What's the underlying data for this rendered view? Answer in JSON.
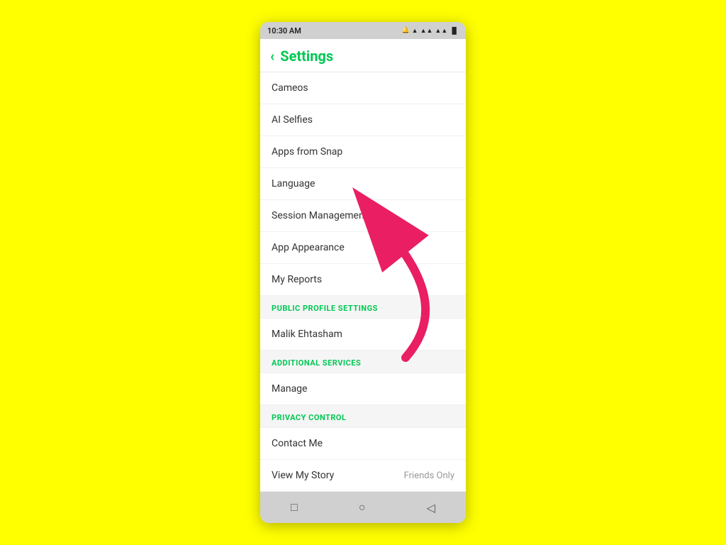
{
  "status_bar": {
    "time": "10:30 AM",
    "icons": "🔔 ▲ ▲▲ ▲▲ ☖ 🔋"
  },
  "header": {
    "back_label": "‹",
    "title": "Settings"
  },
  "menu_items": [
    {
      "label": "Cameos",
      "value": ""
    },
    {
      "label": "AI Selfies",
      "value": ""
    },
    {
      "label": "Apps from Snap",
      "value": ""
    },
    {
      "label": "Language",
      "value": ""
    },
    {
      "label": "Session Management",
      "value": ""
    },
    {
      "label": "App Appearance",
      "value": ""
    },
    {
      "label": "My Reports",
      "value": ""
    }
  ],
  "sections": [
    {
      "header": "PUBLIC PROFILE SETTINGS",
      "items": [
        {
          "label": "Malik Ehtasham",
          "value": ""
        }
      ]
    },
    {
      "header": "ADDITIONAL SERVICES",
      "items": [
        {
          "label": "Manage",
          "value": ""
        }
      ]
    },
    {
      "header": "PRIVACY CONTROL",
      "items": [
        {
          "label": "Contact Me",
          "value": ""
        },
        {
          "label": "View My Story",
          "value": "Friends Only"
        }
      ]
    }
  ],
  "nav_bar": {
    "square_icon": "□",
    "circle_icon": "○",
    "triangle_icon": "◁"
  }
}
